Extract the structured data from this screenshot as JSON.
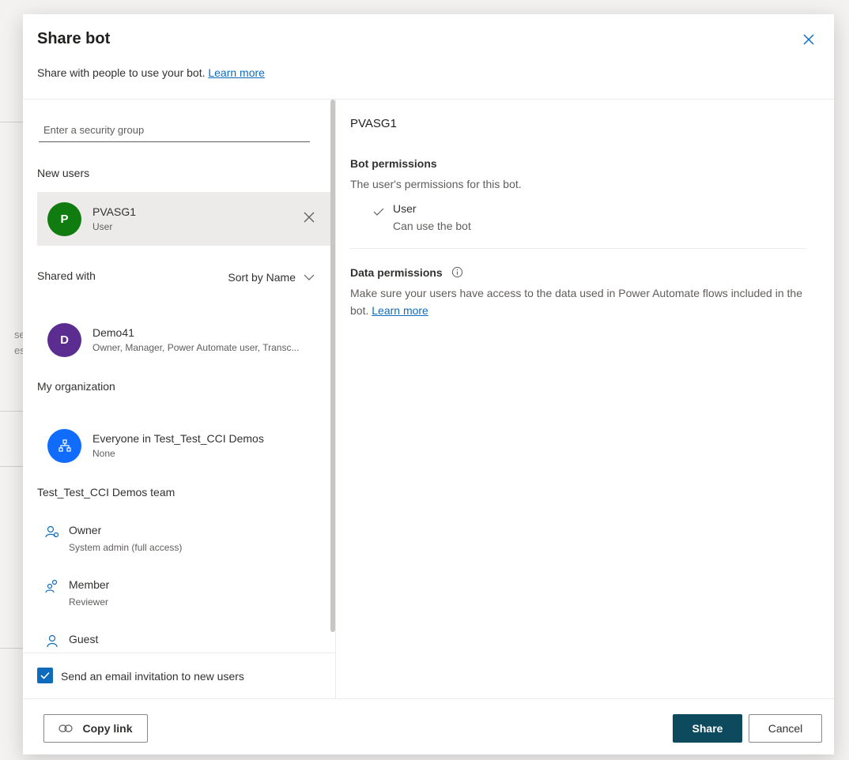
{
  "backdrop": {
    "fragments": [
      "se",
      "es"
    ]
  },
  "dialog": {
    "title": "Share bot",
    "subtitle": "Share with people to use your bot.",
    "subtitle_link": "Learn more"
  },
  "left": {
    "search_placeholder": "Enter a security group",
    "new_users_label": "New users",
    "new_user": {
      "initial": "P",
      "name": "PVASG1",
      "role": "User",
      "avatar_color": "#107c10"
    },
    "shared_with_label": "Shared with",
    "sort_label": "Sort by Name",
    "shared_user": {
      "initial": "D",
      "name": "Demo41",
      "roles": "Owner, Manager, Power Automate user, Transc...",
      "avatar_color": "#5c2d91"
    },
    "org_label": "My organization",
    "org": {
      "name": "Everyone in Test_Test_CCI Demos",
      "role": "None",
      "avatar_color": "#0f6cfd"
    },
    "team_label": "Test_Test_CCI Demos team",
    "team_roles": [
      {
        "icon": "owner-icon",
        "name": "Owner",
        "sub": "System admin (full access)"
      },
      {
        "icon": "member-icon",
        "name": "Member",
        "sub": "Reviewer"
      },
      {
        "icon": "guest-icon",
        "name": "Guest",
        "sub": ""
      }
    ],
    "email_checkbox_label": "Send an email invitation to new users"
  },
  "right": {
    "selected_name": "PVASG1",
    "bot_permissions_title": "Bot permissions",
    "bot_permissions_desc": "The user's permissions for this bot.",
    "permission_name": "User",
    "permission_desc": "Can use the bot",
    "data_permissions_title": "Data permissions",
    "data_permissions_desc": "Make sure your users have access to the data used in Power Automate flows included in the bot.",
    "data_permissions_link": "Learn more"
  },
  "footer": {
    "copy_link": "Copy link",
    "share": "Share",
    "cancel": "Cancel"
  },
  "colors": {
    "accent": "#0f6cbd",
    "primary_button": "#0e4a5e"
  }
}
